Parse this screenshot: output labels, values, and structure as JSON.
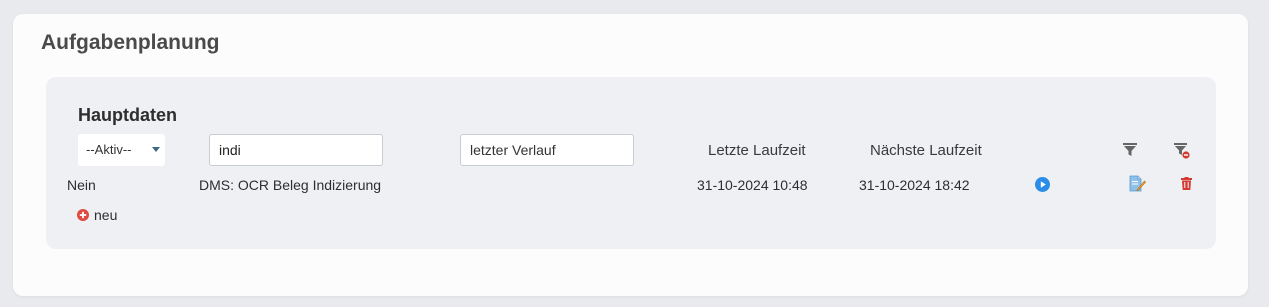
{
  "page": {
    "title": "Aufgabenplanung"
  },
  "section": {
    "title": "Hauptdaten"
  },
  "filters": {
    "active_select": "--Aktiv--",
    "name_value": "indi",
    "history_placeholder": "letzter Verlauf"
  },
  "columns": {
    "last_run": "Letzte Laufzeit",
    "next_run": "Nächste Laufzeit"
  },
  "rows": [
    {
      "active": "Nein",
      "name": "DMS: OCR Beleg Indizierung",
      "last_run": "31-10-2024 10:48",
      "next_run": "31-10-2024 18:42"
    }
  ],
  "actions": {
    "new_label": "neu"
  },
  "icons": {
    "filter": "filter-icon",
    "clear_filter": "filter-remove-icon",
    "run": "play-circle-icon",
    "edit": "edit-icon",
    "delete": "trash-icon",
    "add": "plus-circle-icon"
  },
  "colors": {
    "play": "#2b8de8",
    "delete": "#d23a32",
    "add": "#e04b3f",
    "edit": "#6aa7d8"
  }
}
